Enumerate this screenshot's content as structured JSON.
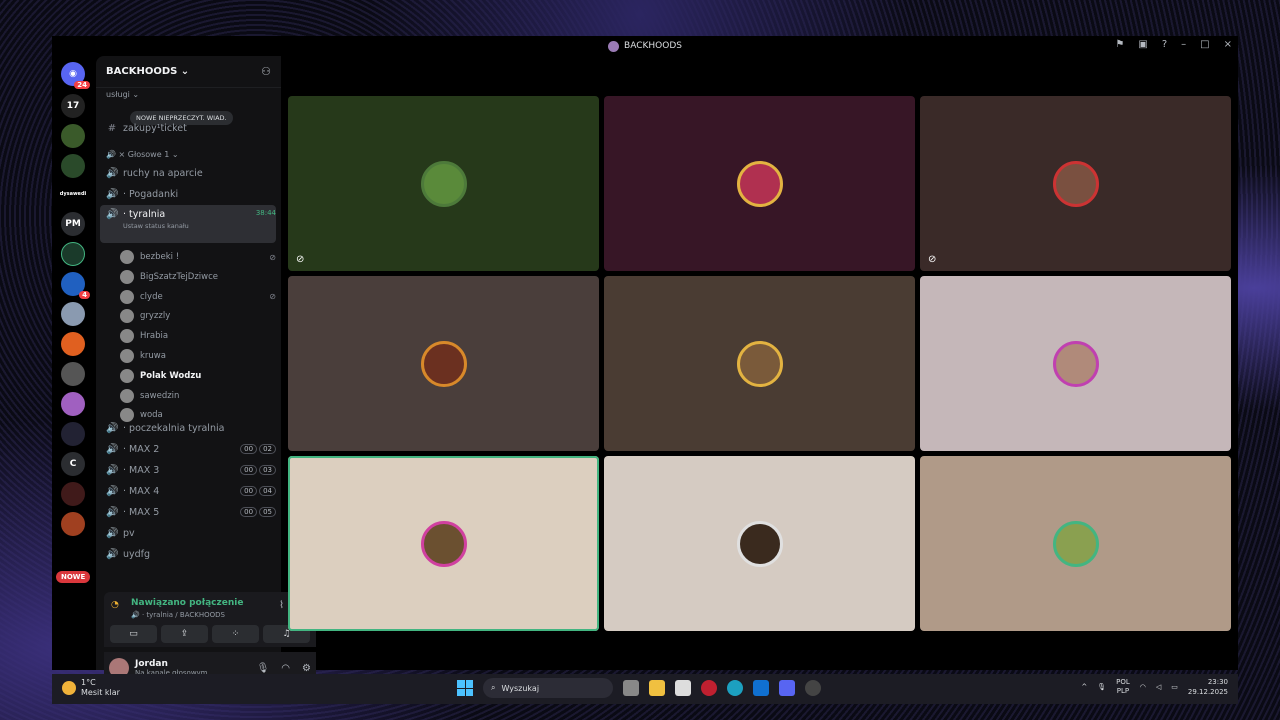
{
  "window": {
    "title": "BACKHOODS"
  },
  "guild": {
    "name": "BACKHOODS"
  },
  "tooltip": "NOWE NIEPRZECZYT. WIAD.",
  "servers": {
    "home_badge": "24",
    "labels": [
      "dysawedi",
      "PM",
      "C"
    ],
    "badge_blue": "4",
    "nowe": "NOWE"
  },
  "categories": [
    {
      "label": "usługi"
    },
    {
      "label": "Głosowe 1"
    }
  ],
  "text_channels": [
    {
      "name": "zakupy¹ticket"
    }
  ],
  "voice_channels": [
    {
      "name": "ruchy na aparcie"
    },
    {
      "name": "· Pogadanki"
    },
    {
      "name": "· tyralnia",
      "timer": "38:44",
      "sub": "Ustaw status kanału"
    },
    {
      "name": "· poczekalnia tyralnia"
    },
    {
      "name": "· MAX 2",
      "a": "00",
      "b": "02"
    },
    {
      "name": "· MAX 3",
      "a": "00",
      "b": "03"
    },
    {
      "name": "· MAX 4",
      "a": "00",
      "b": "04"
    },
    {
      "name": "· MAX 5",
      "a": "00",
      "b": "05"
    },
    {
      "name": "pv"
    },
    {
      "name": "uydfg"
    }
  ],
  "members": [
    {
      "name": "bezbeki !",
      "muted": true
    },
    {
      "name": "BigSzatzTejDziwce",
      "muted": false
    },
    {
      "name": "clyde",
      "muted": true
    },
    {
      "name": "gryzzly",
      "muted": false
    },
    {
      "name": "Hrabia",
      "muted": false
    },
    {
      "name": "kruwa",
      "muted": false
    },
    {
      "name": "Polak Wodzu",
      "muted": false,
      "bold": true
    },
    {
      "name": "sawedzin",
      "muted": false
    },
    {
      "name": "woda",
      "muted": false
    }
  ],
  "voice_status": {
    "connected": "Nawiązano połączenie",
    "channel": "tyralnia / BACKHOODS"
  },
  "user": {
    "name": "Jordan",
    "status": "Na kanale głosowym"
  },
  "tiles": [
    {
      "bg": "#26391a",
      "ring": "#4d7a3a",
      "avatar": "#5a8a3a",
      "muted": true
    },
    {
      "bg": "#371626",
      "ring": "#e3b341",
      "avatar": "#b03050",
      "muted": false
    },
    {
      "bg": "#3a2a28",
      "ring": "#cc3333",
      "avatar": "#7a5040",
      "muted": true
    },
    {
      "bg": "#4a3e3b",
      "ring": "#d8892a",
      "avatar": "#6b3020",
      "muted": false
    },
    {
      "bg": "#4a3c33",
      "ring": "#e3b341",
      "avatar": "#7a5a3a",
      "muted": false
    },
    {
      "bg": "#c5b7b9",
      "ring": "#c040b0",
      "avatar": "#b08a7a",
      "muted": false
    },
    {
      "bg": "#dccfbf",
      "ring": "#d040a0",
      "avatar": "#6b5030",
      "muted": false,
      "speaking": true
    },
    {
      "bg": "#d5cbc2",
      "ring": "#e0e0e0",
      "avatar": "#3a2a1e",
      "muted": false
    },
    {
      "bg": "#b09a88",
      "ring": "#43b581",
      "avatar": "#8aa050",
      "muted": false
    }
  ],
  "taskbar": {
    "temp": "1°C",
    "weather": "Mesit klar",
    "search": "Wyszukaj",
    "lang1": "POL",
    "lang2": "PLP",
    "time": "23:30",
    "date": "29.12.2025"
  }
}
